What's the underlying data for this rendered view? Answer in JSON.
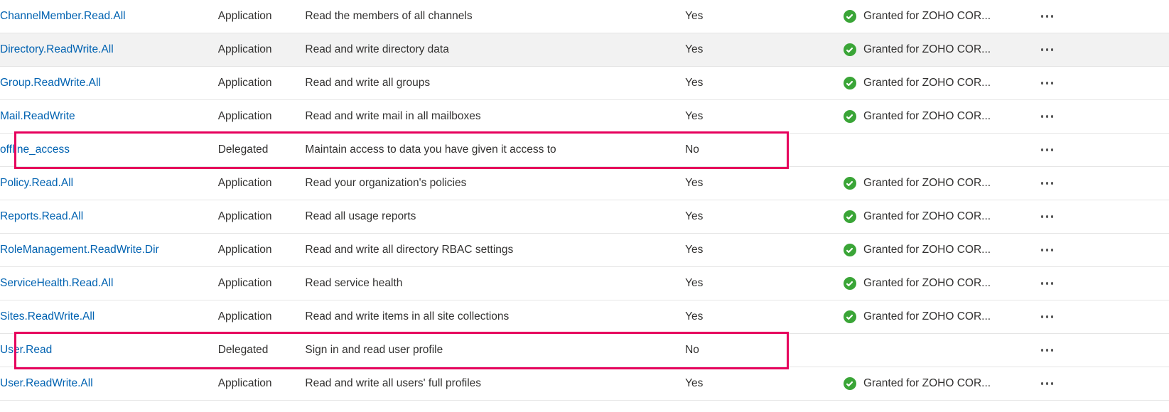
{
  "status_text": "Granted for ZOHO COR...",
  "rows": [
    {
      "name": "ChannelMember.Read.All",
      "type": "Application",
      "desc": "Read the members of all channels",
      "admin": "Yes",
      "granted": true,
      "hovered": false,
      "top_cut": true
    },
    {
      "name": "Directory.ReadWrite.All",
      "type": "Application",
      "desc": "Read and write directory data",
      "admin": "Yes",
      "granted": true,
      "hovered": true
    },
    {
      "name": "Group.ReadWrite.All",
      "type": "Application",
      "desc": "Read and write all groups",
      "admin": "Yes",
      "granted": true,
      "hovered": false
    },
    {
      "name": "Mail.ReadWrite",
      "type": "Application",
      "desc": "Read and write mail in all mailboxes",
      "admin": "Yes",
      "granted": true,
      "hovered": false
    },
    {
      "name": "offline_access",
      "type": "Delegated",
      "desc": "Maintain access to data you have given it access to",
      "admin": "No",
      "granted": false,
      "hovered": false,
      "highlighted": true
    },
    {
      "name": "Policy.Read.All",
      "type": "Application",
      "desc": "Read your organization's policies",
      "admin": "Yes",
      "granted": true,
      "hovered": false
    },
    {
      "name": "Reports.Read.All",
      "type": "Application",
      "desc": "Read all usage reports",
      "admin": "Yes",
      "granted": true,
      "hovered": false
    },
    {
      "name": "RoleManagement.ReadWrite.Dir",
      "type": "Application",
      "desc": "Read and write all directory RBAC settings",
      "admin": "Yes",
      "granted": true,
      "hovered": false
    },
    {
      "name": "ServiceHealth.Read.All",
      "type": "Application",
      "desc": "Read service health",
      "admin": "Yes",
      "granted": true,
      "hovered": false
    },
    {
      "name": "Sites.ReadWrite.All",
      "type": "Application",
      "desc": "Read and write items in all site collections",
      "admin": "Yes",
      "granted": true,
      "hovered": false
    },
    {
      "name": "User.Read",
      "type": "Delegated",
      "desc": "Sign in and read user profile",
      "admin": "No",
      "granted": false,
      "hovered": false,
      "highlighted": true
    },
    {
      "name": "User.ReadWrite.All",
      "type": "Application",
      "desc": "Read and write all users' full profiles",
      "admin": "Yes",
      "granted": true,
      "hovered": false
    }
  ]
}
